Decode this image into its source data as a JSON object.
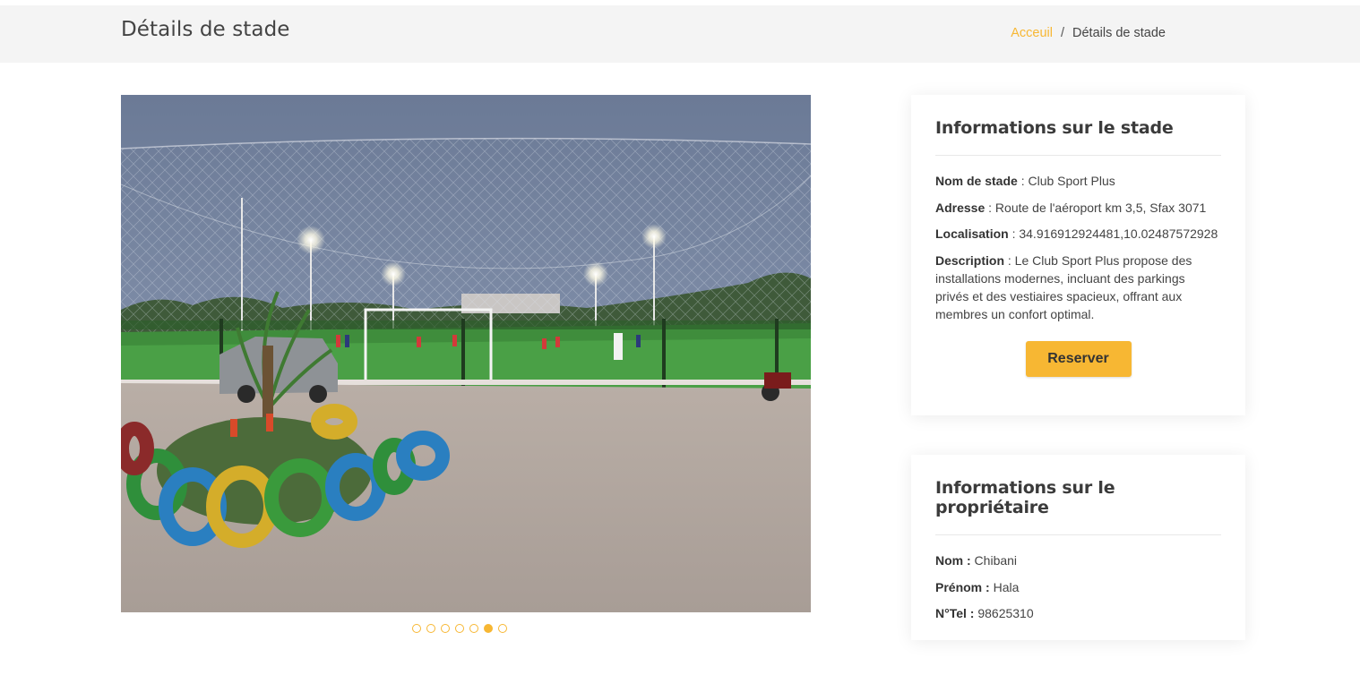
{
  "header": {
    "title": "Détails de stade",
    "breadcrumb": {
      "home": "Acceuil",
      "separator": "/",
      "current": "Détails de stade"
    }
  },
  "gallery": {
    "slide_count": 7,
    "active_slide": 6,
    "accent_color": "#f7b733"
  },
  "stadium": {
    "heading": "Informations sur le stade",
    "name_label": "Nom de stade",
    "name_value": " : Club Sport Plus",
    "address_label": "Adresse",
    "address_value": " : Route de l'aéroport km 3,5, Sfax 3071",
    "location_label": "Localisation",
    "location_value": " : 34.916912924481,10.02487572928",
    "description_label": "Description",
    "description_value": " : Le Club Sport Plus propose des installations modernes, incluant des parkings privés et des vestiaires spacieux, offrant aux membres un confort optimal.",
    "reserve_button": "Reserver"
  },
  "owner": {
    "heading": "Informations sur le propriétaire",
    "lastname_label": "Nom :",
    "lastname_value": " Chibani",
    "firstname_label": "Prénom :",
    "firstname_value": " Hala",
    "phone_label": "N°Tel :",
    "phone_value": " 98625310"
  }
}
